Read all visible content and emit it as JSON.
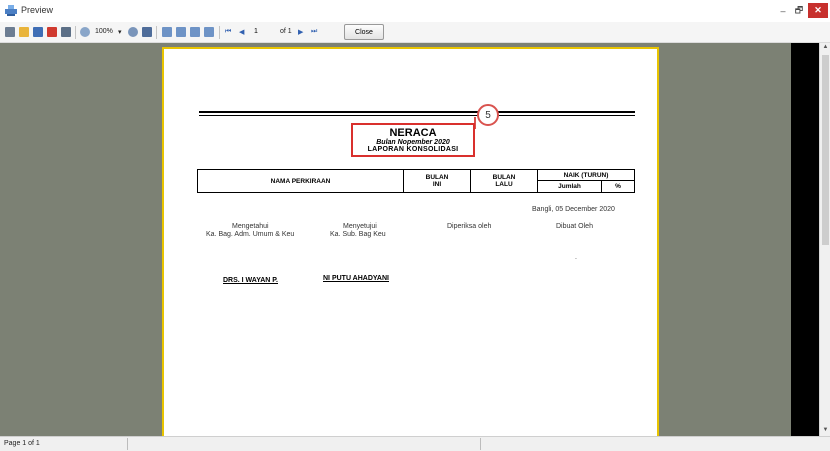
{
  "window": {
    "title": "Preview",
    "minimize": "–",
    "maximize": "🗗",
    "close": "✕"
  },
  "toolbar": {
    "zoom": "100%",
    "zoom_arrow": "▾",
    "page_current": "1",
    "page_of": "of 1",
    "close_label": "Close",
    "first_glyph": "⏮",
    "prev_glyph": "◀",
    "next_glyph": "▶",
    "last_glyph": "⏭",
    "icons": [
      "print-icon",
      "open-icon",
      "save-icon",
      "pdf-icon",
      "find-icon",
      "zoom-icon",
      "page-setup-icon",
      "single-page-icon",
      "two-page-icon",
      "multi-page-icon",
      "edit-icon"
    ]
  },
  "callout": {
    "number": "5"
  },
  "report": {
    "title": "NERACA",
    "period": "Bulan Nopember 2020",
    "subtitle": "LAPORAN KONSOLIDASI",
    "columns": {
      "nama": "NAMA PERKIRAAN",
      "bulan_ini_1": "BULAN",
      "bulan_ini_2": "INI",
      "bulan_lalu_1": "BULAN",
      "bulan_lalu_2": "LALU",
      "naik": "NAIK (TURUN)",
      "jumlah": "Jumlah",
      "persen": "%"
    },
    "place_date": "Bangli, 05 December 2020",
    "signatures": {
      "mengetahui_1": "Mengetahui",
      "mengetahui_2": "Ka. Bag. Adm. Umum & Keu",
      "menyetujui_1": "Menyetujui",
      "menyetujui_2": "Ka. Sub. Bag Keu",
      "diperiksa": "Diperiksa oleh",
      "dibuat": "Dibuat Oleh",
      "dot": ".",
      "name_1": "DRS. I WAYAN P.",
      "name_2": "NI PUTU AHADYANI"
    }
  },
  "status": {
    "page_text": "Page 1 of 1"
  },
  "colors": {
    "viewport": "#7c8174",
    "page_border": "#e8c400",
    "highlight": "#d9302d"
  }
}
